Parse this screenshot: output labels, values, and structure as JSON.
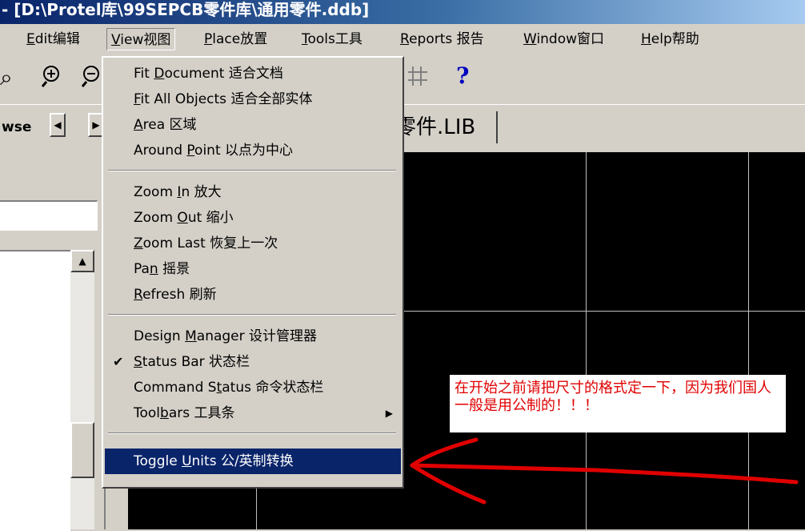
{
  "title_bar": {
    "text": "- [D:\\Protel库\\99SEPCB零件库\\通用零件.ddb]"
  },
  "menu": [
    {
      "label": "Edit编辑",
      "underline_index": 0
    },
    {
      "label": "View视图",
      "underline_index": 0,
      "active": true
    },
    {
      "label": "Place放置",
      "underline_index": 0
    },
    {
      "label": "Tools工具",
      "underline_index": 0
    },
    {
      "label": "Reports 报告",
      "underline_index": 0
    },
    {
      "label": "Window窗口",
      "underline_index": 0
    },
    {
      "label": "Help帮助",
      "underline_index": 0
    }
  ],
  "browse_label": "wse",
  "document_tab": "零件.LIB",
  "view_menu": {
    "groups": [
      [
        {
          "label": "Fit Document 适合文档",
          "underline_index": 4
        },
        {
          "label": "Fit All Objects 适合全部实体",
          "underline_index": 0
        },
        {
          "label": "Area 区域",
          "underline_index": 0
        },
        {
          "label": "Around Point 以点为中心",
          "underline_index": 7
        }
      ],
      [
        {
          "label": "Zoom In 放大",
          "underline_index": 5
        },
        {
          "label": "Zoom Out 缩小",
          "underline_index": 5
        },
        {
          "label": "Zoom Last 恢复上一次",
          "underline_index": 0
        },
        {
          "label": "Pan 摇景",
          "underline_index": 2
        },
        {
          "label": "Refresh 刷新",
          "underline_index": 0
        }
      ],
      [
        {
          "label": "Design Manager 设计管理器",
          "underline_index": 7
        },
        {
          "label": "Status Bar 状态栏",
          "underline_index": 0,
          "checked": true
        },
        {
          "label": "Command Status 命令状态栏",
          "underline_index": 9
        },
        {
          "label": "Toolbars 工具条",
          "underline_index": 4,
          "submenu": true
        }
      ],
      [
        {
          "label": "Toggle Units 公/英制转换",
          "underline_index": 7,
          "highlighted": true
        }
      ]
    ]
  },
  "annotation": {
    "text": "在开始之前请把尺寸的格式定一下，因为我们国人一般是用公制的！！！",
    "color": "#e00000"
  },
  "icons": [
    "zoom-in-icon",
    "zoom-out-icon",
    "grid-icon",
    "help-icon",
    "left-arrow-icon",
    "right-arrow-icon",
    "scroll-up-icon",
    "checkmark-icon",
    "submenu-arrow-icon",
    "annotation-arrow-icon"
  ],
  "colors": {
    "highlight": "#0a246a",
    "canvas": "#000000",
    "grid": "#c0c0c0",
    "annotation": "#e00000"
  }
}
